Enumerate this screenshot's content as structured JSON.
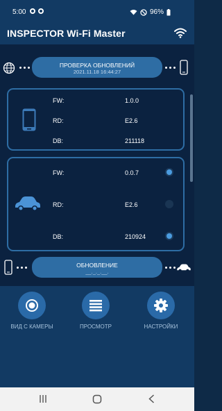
{
  "status_bar": {
    "time": "5:00",
    "battery": "96%"
  },
  "app": {
    "title": "INSPECTOR Wi-Fi Master"
  },
  "update_check": {
    "title": "ПРОВЕРКА ОБНОВЛЕНИЙ",
    "datetime": "2021.11.18 16:44:27"
  },
  "phone_card": {
    "rows": [
      {
        "label": "FW:",
        "value": "1.0.0"
      },
      {
        "label": "RD:",
        "value": "E2.6"
      },
      {
        "label": "DB:",
        "value": "211118"
      }
    ]
  },
  "device_card": {
    "rows": [
      {
        "label": "FW:",
        "value": "0.0.7",
        "selected": true
      },
      {
        "label": "RD:",
        "value": "E2.6",
        "selected": false
      },
      {
        "label": "DB:",
        "value": "210924",
        "selected": true
      }
    ]
  },
  "update": {
    "title": "ОБНОВЛЕНИЕ",
    "progress": "__._._.__."
  },
  "dock": {
    "camera_label": "ВИД С КАМЕРЫ",
    "view_label": "ПРОСМОТР",
    "settings_label": "НАСТРОЙКИ"
  },
  "colors": {
    "accent": "#2e6da4",
    "background": "#0b2240",
    "header": "#123a63",
    "radio_on": "#4b9ce0"
  }
}
